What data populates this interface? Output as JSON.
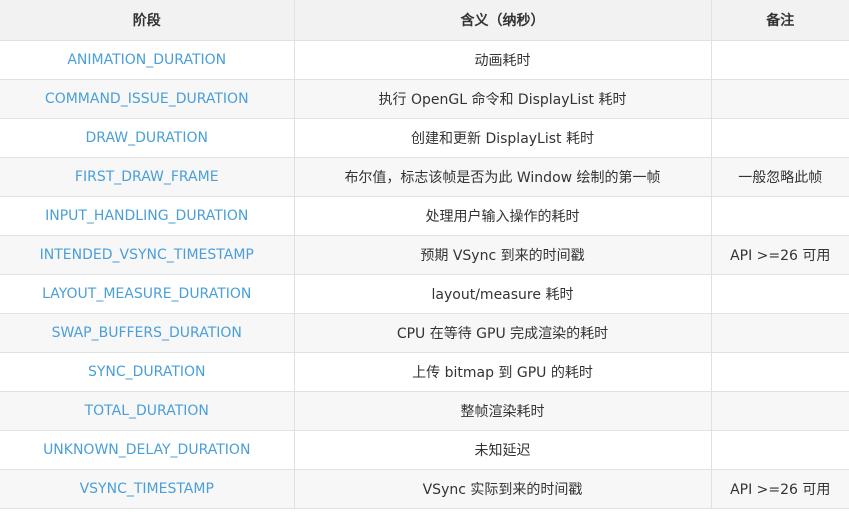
{
  "table": {
    "headers": [
      "阶段",
      "含义（纳秒）",
      "备注"
    ],
    "rows": [
      {
        "stage": "ANIMATION_DURATION",
        "meaning": "动画耗时",
        "note": ""
      },
      {
        "stage": "COMMAND_ISSUE_DURATION",
        "meaning": "执行 OpenGL 命令和 DisplayList 耗时",
        "note": ""
      },
      {
        "stage": "DRAW_DURATION",
        "meaning": "创建和更新 DisplayList 耗时",
        "note": ""
      },
      {
        "stage": "FIRST_DRAW_FRAME",
        "meaning": "布尔值，标志该帧是否为此 Window 绘制的第一帧",
        "note": "一般忽略此帧"
      },
      {
        "stage": "INPUT_HANDLING_DURATION",
        "meaning": "处理用户输入操作的耗时",
        "note": ""
      },
      {
        "stage": "INTENDED_VSYNC_TIMESTAMP",
        "meaning": "预期 VSync 到来的时间戳",
        "note": "API >=26 可用"
      },
      {
        "stage": "LAYOUT_MEASURE_DURATION",
        "meaning": "layout/measure 耗时",
        "note": ""
      },
      {
        "stage": "SWAP_BUFFERS_DURATION",
        "meaning": "CPU 在等待 GPU 完成渲染的耗时",
        "note": ""
      },
      {
        "stage": "SYNC_DURATION",
        "meaning": "上传 bitmap 到 GPU 的耗时",
        "note": ""
      },
      {
        "stage": "TOTAL_DURATION",
        "meaning": "整帧渲染耗时",
        "note": ""
      },
      {
        "stage": "UNKNOWN_DELAY_DURATION",
        "meaning": "未知延迟",
        "note": ""
      },
      {
        "stage": "VSYNC_TIMESTAMP",
        "meaning": "VSync 实际到来的时间戳",
        "note": "API >=26 可用"
      }
    ]
  },
  "colors": {
    "stage_text": "#4a9fd8",
    "header_bg": "#f2f2f2",
    "alt_row_bg": "#f7f7f7",
    "border": "#dfe2e5"
  }
}
